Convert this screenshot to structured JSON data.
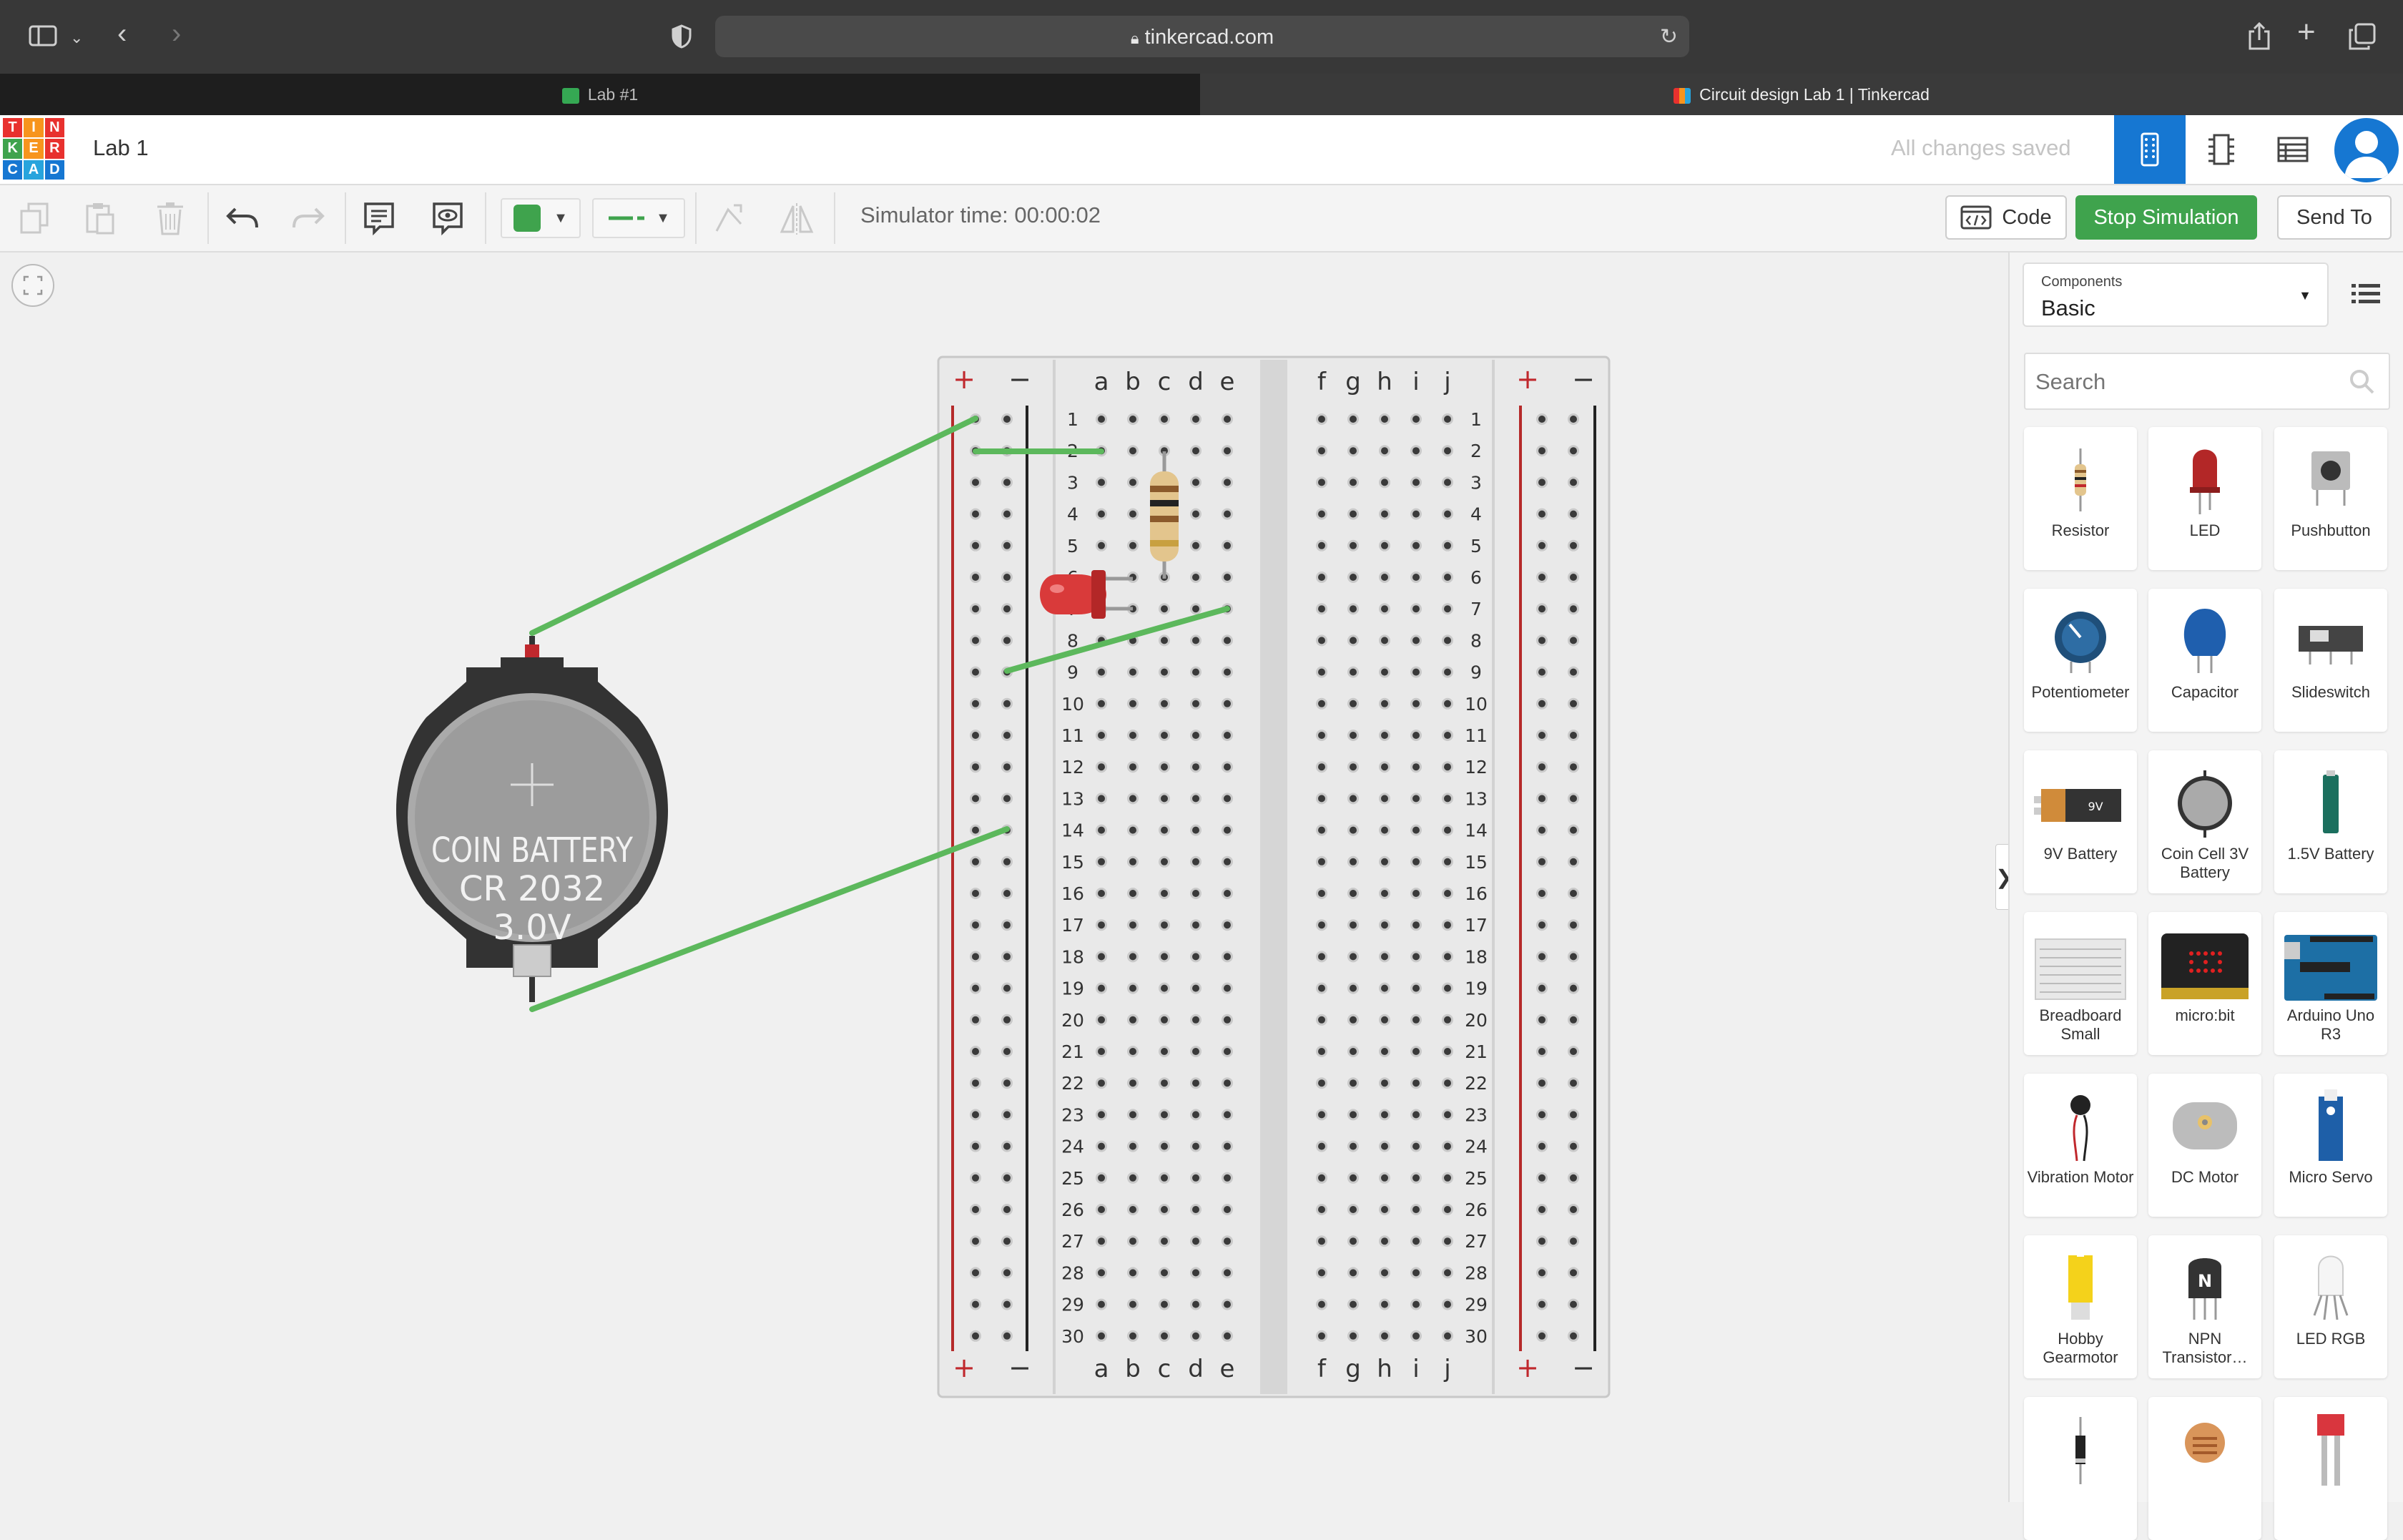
{
  "browser": {
    "url": "tinkercad.com",
    "tabs": [
      {
        "label": "Lab #1"
      },
      {
        "label": "Circuit design Lab 1 | Tinkercad"
      }
    ]
  },
  "header": {
    "logo_letters": [
      "T",
      "I",
      "N",
      "K",
      "E",
      "R",
      "C",
      "A",
      "D"
    ],
    "design_title": "Lab 1",
    "save_status": "All changes saved"
  },
  "toolbar": {
    "sim_time": "Simulator time: 00:00:02",
    "code_label": "Code",
    "stop_label": "Stop Simulation",
    "sendto_label": "Send To",
    "fill_color": "#3fa34d"
  },
  "panel": {
    "components_label": "Components",
    "components_value": "Basic",
    "search_placeholder": "Search",
    "items": [
      {
        "label": "Resistor",
        "icon": "resistor-icon"
      },
      {
        "label": "LED",
        "icon": "led-icon"
      },
      {
        "label": "Pushbutton",
        "icon": "pushbutton-icon"
      },
      {
        "label": "Potentiometer",
        "icon": "potentiometer-icon"
      },
      {
        "label": "Capacitor",
        "icon": "capacitor-icon"
      },
      {
        "label": "Slideswitch",
        "icon": "slideswitch-icon"
      },
      {
        "label": "9V Battery",
        "icon": "battery-9v-icon"
      },
      {
        "label": "Coin Cell 3V Battery",
        "icon": "coin-cell-icon"
      },
      {
        "label": "1.5V Battery",
        "icon": "battery-aa-icon"
      },
      {
        "label": "Breadboard Small",
        "icon": "breadboard-icon"
      },
      {
        "label": "micro:bit",
        "icon": "microbit-icon"
      },
      {
        "label": "Arduino Uno R3",
        "icon": "arduino-icon"
      },
      {
        "label": "Vibration Motor",
        "icon": "vibration-motor-icon"
      },
      {
        "label": "DC Motor",
        "icon": "dc-motor-icon"
      },
      {
        "label": "Micro Servo",
        "icon": "servo-icon"
      },
      {
        "label": "Hobby Gearmotor",
        "icon": "gearmotor-icon"
      },
      {
        "label": "NPN Transistor…",
        "icon": "transistor-icon"
      },
      {
        "label": "LED RGB",
        "icon": "led-rgb-icon"
      },
      {
        "label": "",
        "icon": "diode-icon"
      },
      {
        "label": "",
        "icon": "photoresistor-icon"
      },
      {
        "label": "",
        "icon": "sensor-icon"
      }
    ]
  },
  "circuit": {
    "battery": {
      "line1": "COIN BATTERY",
      "line2": "CR 2032",
      "line3": "3.0V"
    },
    "breadboard": {
      "columns_left": [
        "a",
        "b",
        "c",
        "d",
        "e"
      ],
      "columns_right": [
        "f",
        "g",
        "h",
        "i",
        "j"
      ],
      "rows": 30,
      "plus": "+",
      "minus": "−"
    },
    "wire_color": "#5cb85c"
  }
}
